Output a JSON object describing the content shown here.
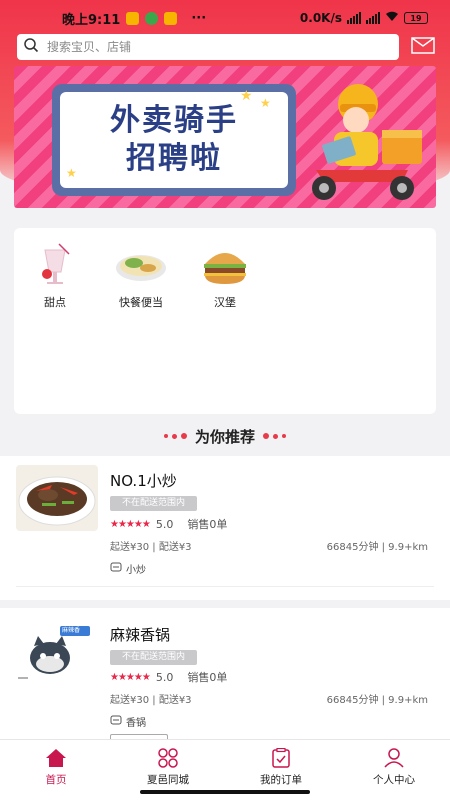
{
  "status_bar": {
    "time": "晚上9:11",
    "more": "···",
    "network_speed": "0.0K/s",
    "battery": "19"
  },
  "search": {
    "placeholder": "搜索宝贝、店铺",
    "search_icon": "search-icon",
    "message_icon": "mail-icon"
  },
  "banner": {
    "line1": "外卖骑手",
    "line2": "招聘啦"
  },
  "categories": [
    {
      "label": "甜点",
      "icon": "dessert-icon"
    },
    {
      "label": "快餐便当",
      "icon": "fast-food-icon"
    },
    {
      "label": "汉堡",
      "icon": "burger-icon"
    }
  ],
  "recommend": {
    "title": "为你推荐"
  },
  "shops": [
    {
      "name": "NO.1小炒",
      "status_tag": "不在配送范围内",
      "rating": "5.0",
      "sales": "销售0单",
      "fees": "起送¥30 | 配送¥3",
      "distance": "66845分钟 | 9.9+km",
      "category": "小炒"
    },
    {
      "name": "麻辣香锅",
      "status_tag": "不在配送范围内",
      "rating": "5.0",
      "sales": "销售0单",
      "fees": "起送¥30 | 配送¥3",
      "distance": "66845分钟 | 9.9+km",
      "category": "香锅",
      "logo_text": "麻辣香"
    }
  ],
  "nav": [
    {
      "label": "首页",
      "icon": "home-icon",
      "active": true
    },
    {
      "label": "夏邑同城",
      "icon": "grid-icon",
      "active": false
    },
    {
      "label": "我的订单",
      "icon": "order-icon",
      "active": false
    },
    {
      "label": "个人中心",
      "icon": "user-icon",
      "active": false
    }
  ],
  "colors": {
    "accent": "#c8174f",
    "header_red": "#f0344a",
    "star": "#e8284a"
  }
}
